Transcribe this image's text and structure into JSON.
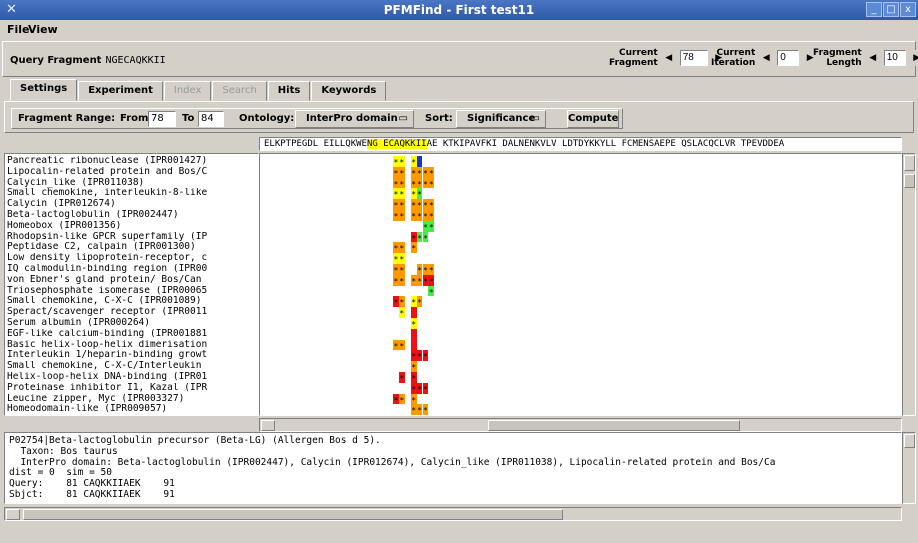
{
  "window": {
    "title": "PFMFind - First test11",
    "minimize": "_",
    "maximize": "□",
    "close": "x"
  },
  "menu": [
    "File",
    "View"
  ],
  "query": {
    "label": "Query Fragment",
    "value": "NGECAQKKII",
    "current_fragment": {
      "label1": "Current",
      "label2": "Fragment",
      "value": "78"
    },
    "current_iteration": {
      "label1": "Current",
      "label2": "Iteration",
      "value": "0"
    },
    "fragment_length": {
      "label1": "Fragment",
      "label2": "Length",
      "value": "10"
    }
  },
  "tabs": [
    {
      "label": "Settings",
      "enabled": true
    },
    {
      "label": "Experiment",
      "enabled": true
    },
    {
      "label": "Index",
      "enabled": false
    },
    {
      "label": "Search",
      "enabled": false
    },
    {
      "label": "Hits",
      "enabled": true
    },
    {
      "label": "Keywords",
      "enabled": true
    }
  ],
  "options": {
    "fragment_range_label": "Fragment Range:",
    "from_label": "From",
    "from_value": "78",
    "to_label": "To",
    "to_value": "84",
    "ontology_label": "Ontology:",
    "ontology_value": "InterPro domain",
    "sort_label": "Sort:",
    "sort_value": "Significance",
    "compute_label": "Compute"
  },
  "sequence": {
    "before": "ELKPTPEGDL EILLQKWE",
    "highlight": "NG ECAQKKII",
    "after": "AE KTKIPAVFKI DALNENKVLV LDTDYKKYLL FCMENSAEPE QSLACQCLVR TPEVDDEA"
  },
  "keywords": [
    "Pancreatic ribonuclease (IPR001427)",
    "Lipocalin-related protein and Bos/C",
    "Calycin_like (IPR011038)",
    "Small chemokine, interleukin-8-like",
    "Calycin (IPR012674)",
    "Beta-lactoglobulin (IPR002447)",
    "Homeobox (IPR001356)",
    "Rhodopsin-like GPCR superfamily (IP",
    "Peptidase C2, calpain (IPR001300)",
    "Low density lipoprotein-receptor, c",
    "IQ calmodulin-binding region (IPR00",
    "von Ebner's gland protein/ Bos/Can",
    "Triosephosphate isomerase (IPR00065",
    "Small chemokine, C-X-C (IPR001089)",
    "Speract/scavenger receptor (IPR0011",
    "Serum albumin (IPR000264)",
    "EGF-like calcium-binding (IPR001881",
    "Basic helix-loop-helix dimerisation",
    "Interleukin 1/heparin-binding growt",
    "Small chemokine, C-X-C/Interleukin",
    "Helix-loop-helix DNA-binding (IPR01",
    "Proteinase inhibitor I1, Kazal (IPR",
    "Leucine zipper, Myc (IPR003327)",
    "Homeodomain-like (IPR009057)"
  ],
  "legend_colors": {
    "yellow": "#ffff00",
    "orange": "#ff9900",
    "red": "#ee1111",
    "green": "#44ee44",
    "blue": "#1133dd"
  },
  "match_grid": [
    [
      [
        "y",
        "*"
      ],
      [
        "y",
        "*"
      ],
      null,
      [
        "y",
        "*"
      ],
      [
        "b",
        ""
      ]
    ],
    [
      [
        "o",
        "*"
      ],
      [
        "o",
        "*"
      ],
      null,
      [
        "o",
        "*"
      ],
      [
        "o",
        "*"
      ],
      [
        "o",
        "*"
      ],
      [
        "o",
        "*"
      ]
    ],
    [
      [
        "o",
        "*"
      ],
      [
        "o",
        "*"
      ],
      null,
      [
        "o",
        "*"
      ],
      [
        "o",
        "*"
      ],
      [
        "o",
        "*"
      ],
      [
        "o",
        "*"
      ]
    ],
    [
      [
        "y",
        "*"
      ],
      [
        "y",
        "*"
      ],
      null,
      [
        "y",
        "*"
      ],
      [
        "g",
        "*"
      ]
    ],
    [
      [
        "o",
        "*"
      ],
      [
        "o",
        "*"
      ],
      null,
      [
        "o",
        "*"
      ],
      [
        "o",
        "*"
      ],
      [
        "o",
        "*"
      ],
      [
        "o",
        "*"
      ]
    ],
    [
      [
        "o",
        "*"
      ],
      [
        "o",
        "*"
      ],
      null,
      [
        "o",
        "*"
      ],
      [
        "o",
        "*"
      ],
      [
        "o",
        "*"
      ],
      [
        "o",
        "*"
      ]
    ],
    [
      null,
      null,
      null,
      null,
      null,
      [
        "g",
        "*"
      ],
      [
        "g",
        "*"
      ]
    ],
    [
      null,
      null,
      null,
      [
        "r",
        "*"
      ],
      [
        "g",
        "*"
      ],
      [
        "g",
        "*"
      ]
    ],
    [
      [
        "o",
        "*"
      ],
      [
        "o",
        "*"
      ],
      null,
      [
        "o",
        "*"
      ]
    ],
    [
      [
        "y",
        "*"
      ],
      [
        "y",
        "*"
      ]
    ],
    [
      [
        "o",
        "*"
      ],
      [
        "o",
        "*"
      ],
      null,
      null,
      [
        "o",
        "*"
      ],
      [
        "o",
        "*"
      ],
      [
        "o",
        "*"
      ]
    ],
    [
      [
        "o",
        "*"
      ],
      [
        "o",
        "*"
      ],
      null,
      [
        "o",
        "*"
      ],
      [
        "o",
        "*"
      ],
      [
        "r",
        "*"
      ],
      [
        "r",
        "*"
      ]
    ],
    [
      null,
      null,
      null,
      null,
      null,
      null,
      [
        "g",
        "*"
      ]
    ],
    [
      [
        "r",
        "*"
      ],
      [
        "o",
        "*"
      ],
      null,
      [
        "y",
        "*"
      ],
      [
        "o",
        "*"
      ]
    ],
    [
      null,
      [
        "y",
        "*"
      ],
      null,
      [
        "r",
        ""
      ]
    ],
    [
      null,
      null,
      null,
      [
        "y",
        "*"
      ]
    ],
    [
      null,
      null,
      null,
      [
        "r",
        ""
      ]
    ],
    [
      [
        "o",
        "*"
      ],
      [
        "o",
        "*"
      ],
      null,
      [
        "r",
        ""
      ]
    ],
    [
      null,
      null,
      null,
      [
        "r",
        "*"
      ],
      [
        "r",
        "*"
      ],
      [
        "r",
        "*"
      ]
    ],
    [
      null,
      null,
      null,
      [
        "o",
        "*"
      ]
    ],
    [
      null,
      [
        "r",
        "*"
      ],
      null,
      [
        "r",
        "*"
      ]
    ],
    [
      null,
      null,
      null,
      [
        "r",
        "*"
      ],
      [
        "r",
        "*"
      ],
      [
        "r",
        "*"
      ]
    ],
    [
      [
        "r",
        "*"
      ],
      [
        "o",
        "*"
      ],
      null,
      [
        "o",
        "*"
      ]
    ],
    [
      null,
      null,
      null,
      [
        "o",
        "*"
      ],
      [
        "o",
        "*"
      ],
      [
        "o",
        "*"
      ]
    ],
    [
      null,
      null,
      null,
      null,
      [
        "o",
        "*"
      ],
      [
        "o",
        "*"
      ]
    ]
  ],
  "detail": [
    "P02754|Beta-lactoglobulin precursor (Beta-LG) (Allergen Bos d 5).",
    "  Taxon: Bos taurus",
    "  InterPro domain: Beta-lactoglobulin (IPR002447), Calycin (IPR012674), Calycin_like (IPR011038), Lipocalin-related protein and Bos/Ca",
    "dist = 0  sim = 50",
    "Query:    81 CAQKKIIAEK    91",
    "Sbjct:    81 CAQKKIIAEK    91"
  ]
}
